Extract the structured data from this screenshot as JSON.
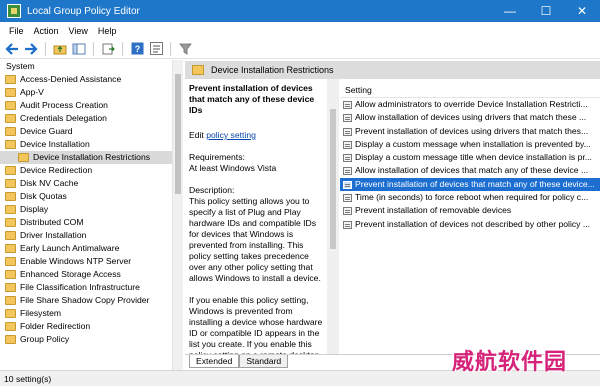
{
  "window": {
    "title": "Local Group Policy Editor",
    "minimize_icon": "minimize-icon",
    "maximize_icon": "maximize-icon",
    "close_icon": "close-icon"
  },
  "menu": [
    "File",
    "Action",
    "View",
    "Help"
  ],
  "toolbar": {
    "icons": [
      "back-arrow-icon",
      "forward-arrow-icon",
      "up-folder-icon",
      "show-hide-tree-icon",
      "export-list-icon",
      "help-icon",
      "properties-icon",
      "filter-icon"
    ]
  },
  "tree": {
    "root": "System",
    "items": [
      "Access-Denied Assistance",
      "App-V",
      "Audit Process Creation",
      "Credentials Delegation",
      "Device Guard",
      "Device Installation",
      "Device Installation Restrictions",
      "Device Redirection",
      "Disk NV Cache",
      "Disk Quotas",
      "Display",
      "Distributed COM",
      "Driver Installation",
      "Early Launch Antimalware",
      "Enable Windows NTP Server",
      "Enhanced Storage Access",
      "File Classification Infrastructure",
      "File Share Shadow Copy Provider",
      "Filesystem",
      "Folder Redirection",
      "Group Policy"
    ],
    "selected": "Device Installation Restrictions"
  },
  "right_header": "Device Installation Restrictions",
  "description": {
    "title": "Prevent installation of devices that match any of these device IDs",
    "edit_prefix": "Edit",
    "edit_link": "policy setting",
    "requirements_label": "Requirements:",
    "requirements_value": "At least Windows Vista",
    "description_label": "Description:",
    "paragraph1": "This policy setting allows you to specify a list of Plug and Play hardware IDs and compatible IDs for devices that Windows is prevented from installing. This policy setting takes precedence over any other policy setting that allows Windows to install a device.",
    "paragraph2": "If you enable this policy setting, Windows is prevented from installing a device whose hardware ID or compatible ID appears in the list you create. If you enable this policy setting on a remote desktop server, the policy"
  },
  "list": {
    "column_header": "Setting",
    "rows": [
      "Allow administrators to override Device Installation Restricti...",
      "Allow installation of devices using drivers that match these ...",
      "Prevent installation of devices using drivers that match thes...",
      "Display a custom message when installation is prevented by...",
      "Display a custom message title when device installation is pr...",
      "Allow installation of devices that match any of these device ...",
      "Prevent installation of devices that match any of these device...",
      "Time (in seconds) to force reboot when required for policy c...",
      "Prevent installation of removable devices",
      "Prevent installation of devices not described by other policy ..."
    ],
    "selected_index": 6
  },
  "tabs": [
    "Extended",
    "Standard"
  ],
  "status": "10 setting(s)",
  "watermark": "威航软件园"
}
